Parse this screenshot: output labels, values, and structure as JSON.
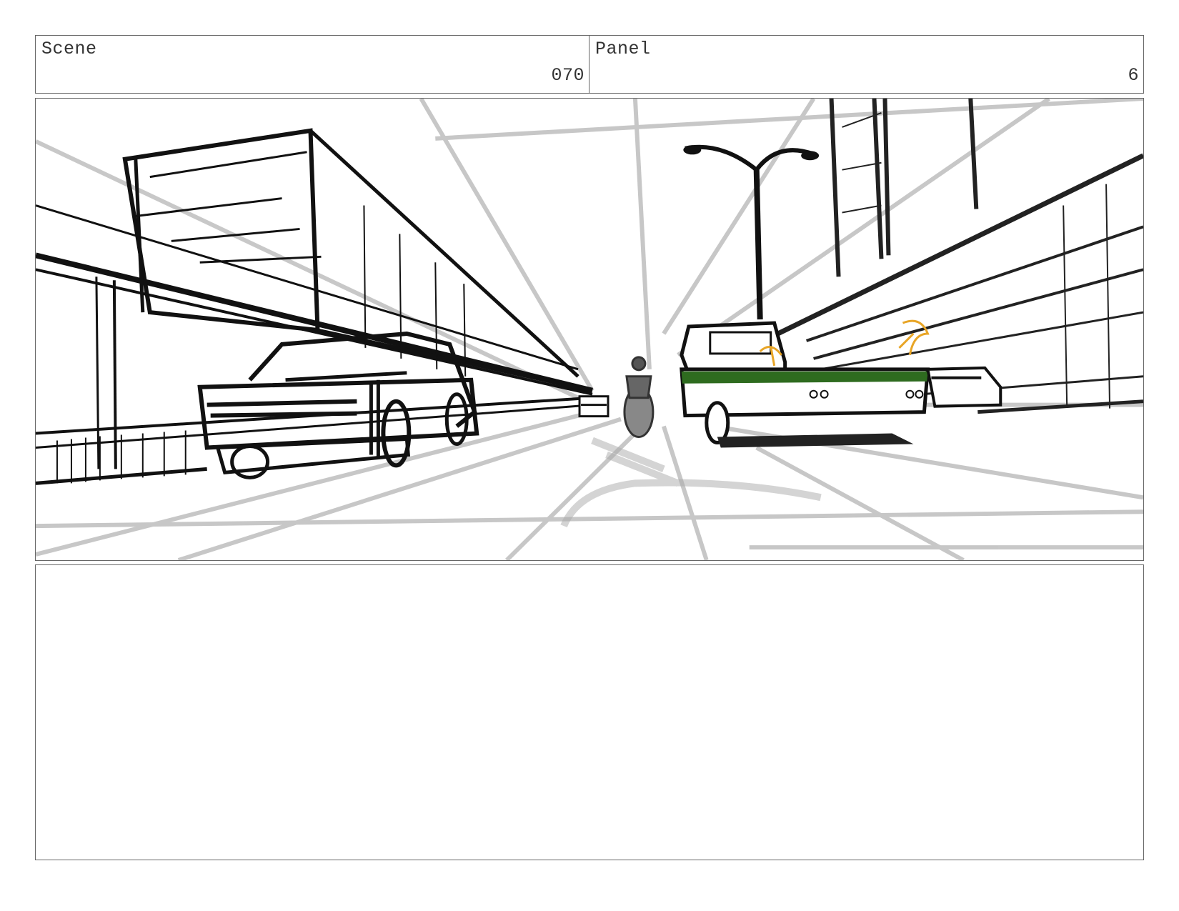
{
  "header": {
    "scene_label": "Scene",
    "scene_number": "070",
    "panel_label": "Panel",
    "panel_number": "6"
  },
  "sketch": {
    "description_icon": "storyboard-sketch-highway-chase",
    "accent_colors": {
      "truck_stripe": "#2e6b1f",
      "figures": "#e8a526",
      "ink": "#111111",
      "guide_lines": "#9a9a9a"
    }
  },
  "notes": {
    "text": ""
  }
}
